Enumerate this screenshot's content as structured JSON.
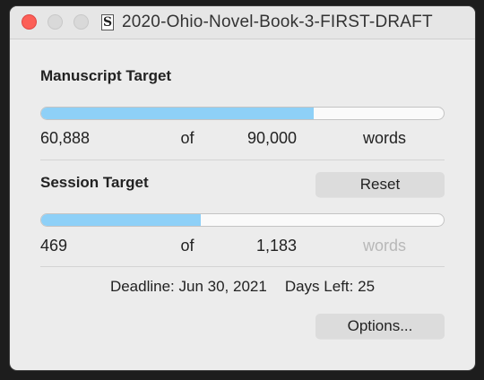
{
  "window": {
    "title": "2020-Ohio-Novel-Book-3-FIRST-DRAFT",
    "doc_icon_glyph": "S"
  },
  "manuscript": {
    "heading": "Manuscript Target",
    "progress": 0.6765,
    "current": "60,888",
    "of_label": "of",
    "target": "90,000",
    "unit": "words"
  },
  "session": {
    "heading": "Session Target",
    "reset_label": "Reset",
    "progress": 0.3965,
    "current": "469",
    "of_label": "of",
    "target": "1,183",
    "unit": "words"
  },
  "deadline": {
    "label": "Deadline:",
    "date": "Jun 30, 2021",
    "days_left_label": "Days Left:",
    "days_left": "25"
  },
  "options_label": "Options...",
  "colors": {
    "progress_fill": "#8ed0f7",
    "close": "#fc5f57"
  }
}
